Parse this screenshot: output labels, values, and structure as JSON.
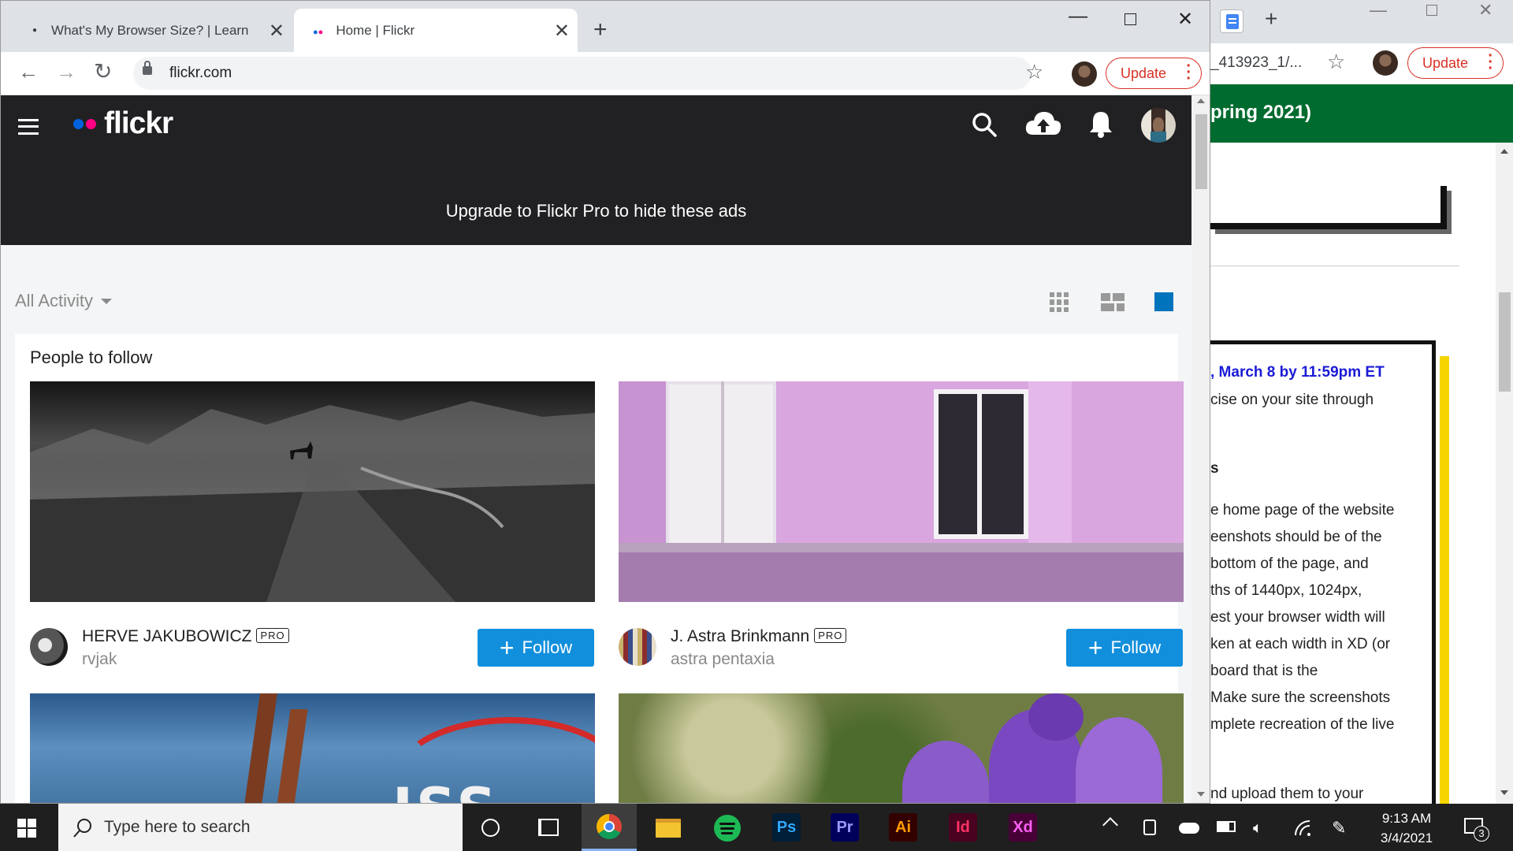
{
  "browser": {
    "tabs": [
      {
        "title": "What's My Browser Size? | Learn"
      },
      {
        "title": "Home | Flickr"
      }
    ],
    "url": "flickr.com",
    "update_label": "Update"
  },
  "flickr": {
    "logo_text": "flickr",
    "ad_text": "Upgrade to Flickr Pro to hide these ads",
    "filter_label": "All Activity",
    "section_title": "People to follow",
    "pro_badge": "PRO",
    "follow_label": "Follow",
    "people": [
      {
        "name": "HERVE JAKUBOWICZ",
        "username": "rvjak"
      },
      {
        "name": "J. Astra Brinkmann",
        "username": "astra pentaxia"
      }
    ]
  },
  "right_window": {
    "tab_text": "_413923_1/...",
    "update_label": "Update",
    "banner": "pring 2021)",
    "deadline": ", March 8 by 11:59pm ET",
    "lines": [
      "cise on your site through",
      "s",
      "e home page of the website",
      "eenshots should be of the",
      "bottom of the page, and",
      "ths of 1440px, 1024px,",
      "est your browser width will",
      "ken at each width in XD (or",
      "board that is the",
      "Make sure the screenshots",
      "mplete recreation of the live",
      "nd upload them to your"
    ]
  },
  "taskbar": {
    "search_placeholder": "Type here to search",
    "time": "9:13 AM",
    "date": "3/4/2021",
    "notification_count": "3",
    "apps": [
      "Ps",
      "Pr",
      "Ai",
      "Id",
      "Xd"
    ]
  },
  "colors": {
    "flickr_blue": "#0063dc",
    "flickr_pink": "#ff0084",
    "follow_button": "#128fdc",
    "header_bg": "#212124",
    "update_red": "#d93025",
    "banner_green": "#006b2e"
  }
}
